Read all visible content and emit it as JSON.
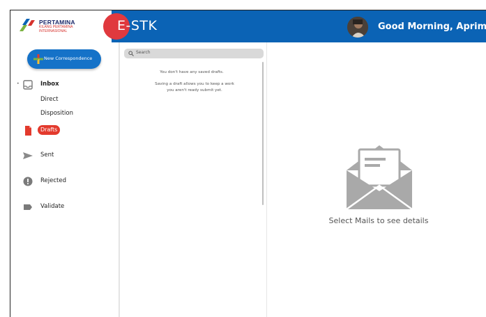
{
  "header": {
    "logo_title": "PERTAMINA",
    "logo_subtitle": "KILANG PERTAMINA INTERNASIONAL",
    "app_name": "E-STK",
    "greeting": "Good Morning, Aprimal",
    "colors": {
      "bar": "#0b63b5",
      "brand_circle": "#e0393e"
    }
  },
  "sidebar": {
    "compose_label": "New Correspondence",
    "items": [
      {
        "key": "inbox",
        "label": "Inbox",
        "icon": "inbox-icon"
      },
      {
        "key": "direct",
        "label": "Direct"
      },
      {
        "key": "disposition",
        "label": "Disposition"
      },
      {
        "key": "drafts",
        "label": "Drafts",
        "icon": "file-icon",
        "selected": true
      },
      {
        "key": "sent",
        "label": "Sent",
        "icon": "send-icon"
      },
      {
        "key": "rejected",
        "label": "Rejected",
        "icon": "alert-icon"
      },
      {
        "key": "validate",
        "label": "Validate",
        "icon": "label-icon"
      }
    ]
  },
  "list": {
    "search_placeholder": "Search",
    "empty_title": "You don't have any saved drafts.",
    "empty_hint_line1": "Saving a draft allows you to keep a work",
    "empty_hint_line2": "you aren't ready submit yet."
  },
  "detail": {
    "empty_message": "Select Mails to see details",
    "icon": "envelope-open-icon"
  }
}
